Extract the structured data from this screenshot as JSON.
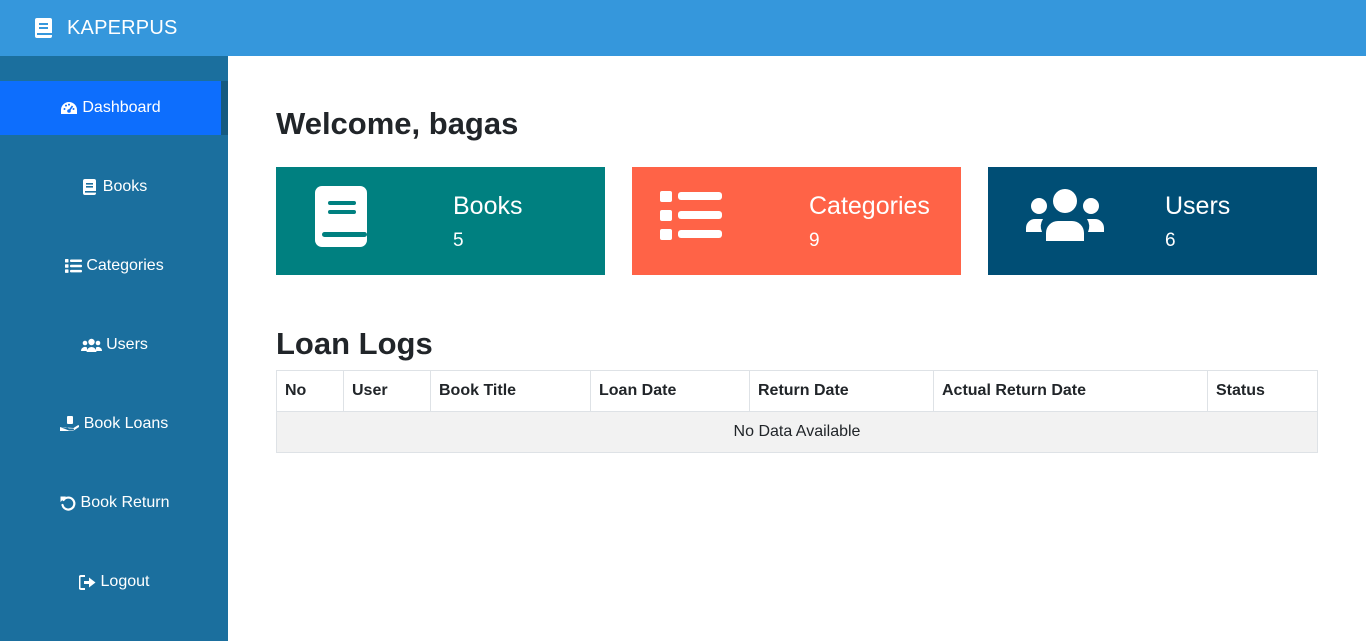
{
  "app": {
    "title": "KAPERPUS",
    "icon": "book-icon"
  },
  "sidebar": {
    "items": [
      {
        "label": "Dashboard",
        "icon": "gauge-icon",
        "active": true
      },
      {
        "label": "Books",
        "icon": "book-icon",
        "active": false
      },
      {
        "label": "Categories",
        "icon": "list-icon",
        "active": false
      },
      {
        "label": "Users",
        "icon": "users-icon",
        "active": false
      },
      {
        "label": "Book Loans",
        "icon": "hand-book-icon",
        "active": false
      },
      {
        "label": "Book Return",
        "icon": "undo-icon",
        "active": false
      },
      {
        "label": "Logout",
        "icon": "logout-icon",
        "active": false
      }
    ]
  },
  "main": {
    "welcome": "Welcome, bagas",
    "cards": [
      {
        "title": "Books",
        "value": "5",
        "icon": "book-icon",
        "color": "#008080"
      },
      {
        "title": "Categories",
        "value": "9",
        "icon": "list-icon",
        "color": "#ff6347"
      },
      {
        "title": "Users",
        "value": "6",
        "icon": "users-icon",
        "color": "#004e75"
      }
    ],
    "loan_logs": {
      "title": "Loan Logs",
      "columns": [
        "No",
        "User",
        "Book Title",
        "Loan Date",
        "Return Date",
        "Actual Return Date",
        "Status"
      ],
      "empty_text": "No Data Available"
    }
  },
  "colors": {
    "topbar": "#3597dc",
    "sidebar": "#1b6f9e",
    "active": "#0d6efd"
  }
}
